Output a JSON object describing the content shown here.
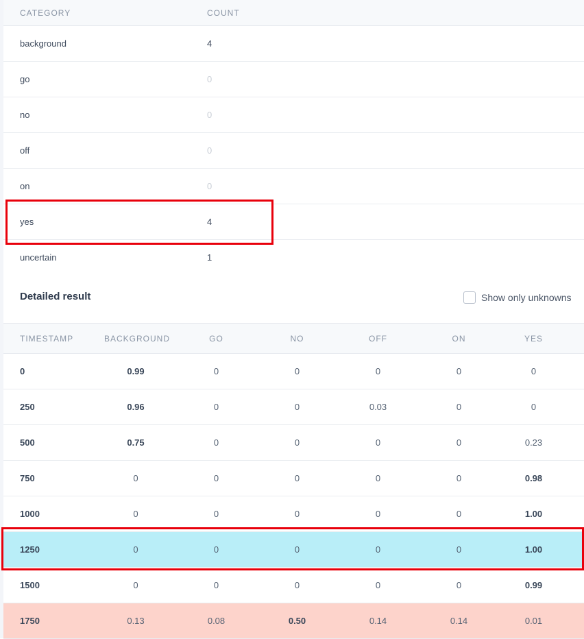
{
  "summary": {
    "headers": {
      "category": "CATEGORY",
      "count": "COUNT"
    },
    "rows": [
      {
        "category": "background",
        "count": "4"
      },
      {
        "category": "go",
        "count": "0"
      },
      {
        "category": "no",
        "count": "0"
      },
      {
        "category": "off",
        "count": "0"
      },
      {
        "category": "on",
        "count": "0"
      },
      {
        "category": "yes",
        "count": "4"
      },
      {
        "category": "uncertain",
        "count": "1"
      }
    ]
  },
  "detail": {
    "title": "Detailed result",
    "filter_label": "Show only unknowns",
    "headers": {
      "timestamp": "TIMESTAMP",
      "background": "BACKGROUND",
      "go": "GO",
      "no": "NO",
      "off": "OFF",
      "on": "ON",
      "yes": "YES"
    },
    "rows": [
      {
        "timestamp": "0",
        "background": "0.99",
        "go": "0",
        "no": "0",
        "off": "0",
        "on": "0",
        "yes": "0"
      },
      {
        "timestamp": "250",
        "background": "0.96",
        "go": "0",
        "no": "0",
        "off": "0.03",
        "on": "0",
        "yes": "0"
      },
      {
        "timestamp": "500",
        "background": "0.75",
        "go": "0",
        "no": "0",
        "off": "0",
        "on": "0",
        "yes": "0.23"
      },
      {
        "timestamp": "750",
        "background": "0",
        "go": "0",
        "no": "0",
        "off": "0",
        "on": "0",
        "yes": "0.98"
      },
      {
        "timestamp": "1000",
        "background": "0",
        "go": "0",
        "no": "0",
        "off": "0",
        "on": "0",
        "yes": "1.00"
      },
      {
        "timestamp": "1250",
        "background": "0",
        "go": "0",
        "no": "0",
        "off": "0",
        "on": "0",
        "yes": "1.00"
      },
      {
        "timestamp": "1500",
        "background": "0",
        "go": "0",
        "no": "0",
        "off": "0",
        "on": "0",
        "yes": "0.99"
      },
      {
        "timestamp": "1750",
        "background": "0.13",
        "go": "0.08",
        "no": "0.50",
        "off": "0.14",
        "on": "0.14",
        "yes": "0.01"
      }
    ]
  },
  "colors": {
    "highlight_blue": "#b9eef8",
    "highlight_red": "#fdd3cb",
    "annotation_red": "#e8000b"
  }
}
